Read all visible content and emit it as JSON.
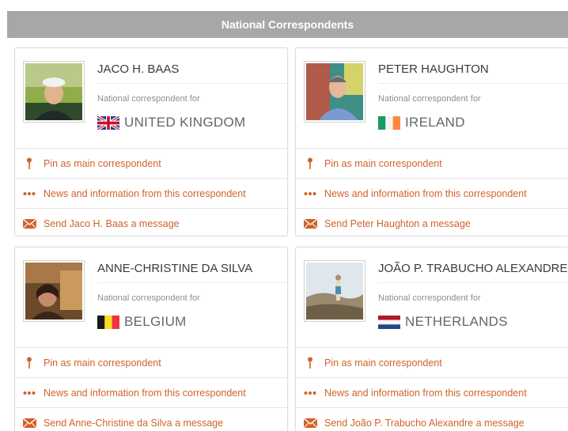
{
  "header": {
    "title": "National Correspondents"
  },
  "colors": {
    "accent": "#d1622a",
    "header_bg": "#a7a7a7"
  },
  "cards": [
    {
      "name": "JACO H. BAAS",
      "role": "National correspondent for",
      "country": "UNITED KINGDOM",
      "flag": "uk-flag-icon",
      "actions": {
        "pin": "Pin as main correspondent",
        "news": "News and information from this correspondent",
        "message": "Send Jaco H. Baas a message"
      }
    },
    {
      "name": "PETER HAUGHTON",
      "role": "National correspondent for",
      "country": "IRELAND",
      "flag": "ireland-flag-icon",
      "actions": {
        "pin": "Pin as main correspondent",
        "news": "News and information from this correspondent",
        "message": "Send Peter Haughton a message"
      }
    },
    {
      "name": "ANNE-CHRISTINE DA SILVA",
      "role": "National correspondent for",
      "country": "BELGIUM",
      "flag": "belgium-flag-icon",
      "actions": {
        "pin": "Pin as main correspondent",
        "news": "News and information from this correspondent",
        "message": "Send Anne-Christine da Silva a message"
      }
    },
    {
      "name": "JOÃO P. TRABUCHO ALEXANDRE",
      "role": "National correspondent for",
      "country": "NETHERLANDS",
      "flag": "netherlands-flag-icon",
      "actions": {
        "pin": "Pin as main correspondent",
        "news": "News and information from this correspondent",
        "message": "Send João P. Trabucho Alexandre a message"
      }
    }
  ]
}
